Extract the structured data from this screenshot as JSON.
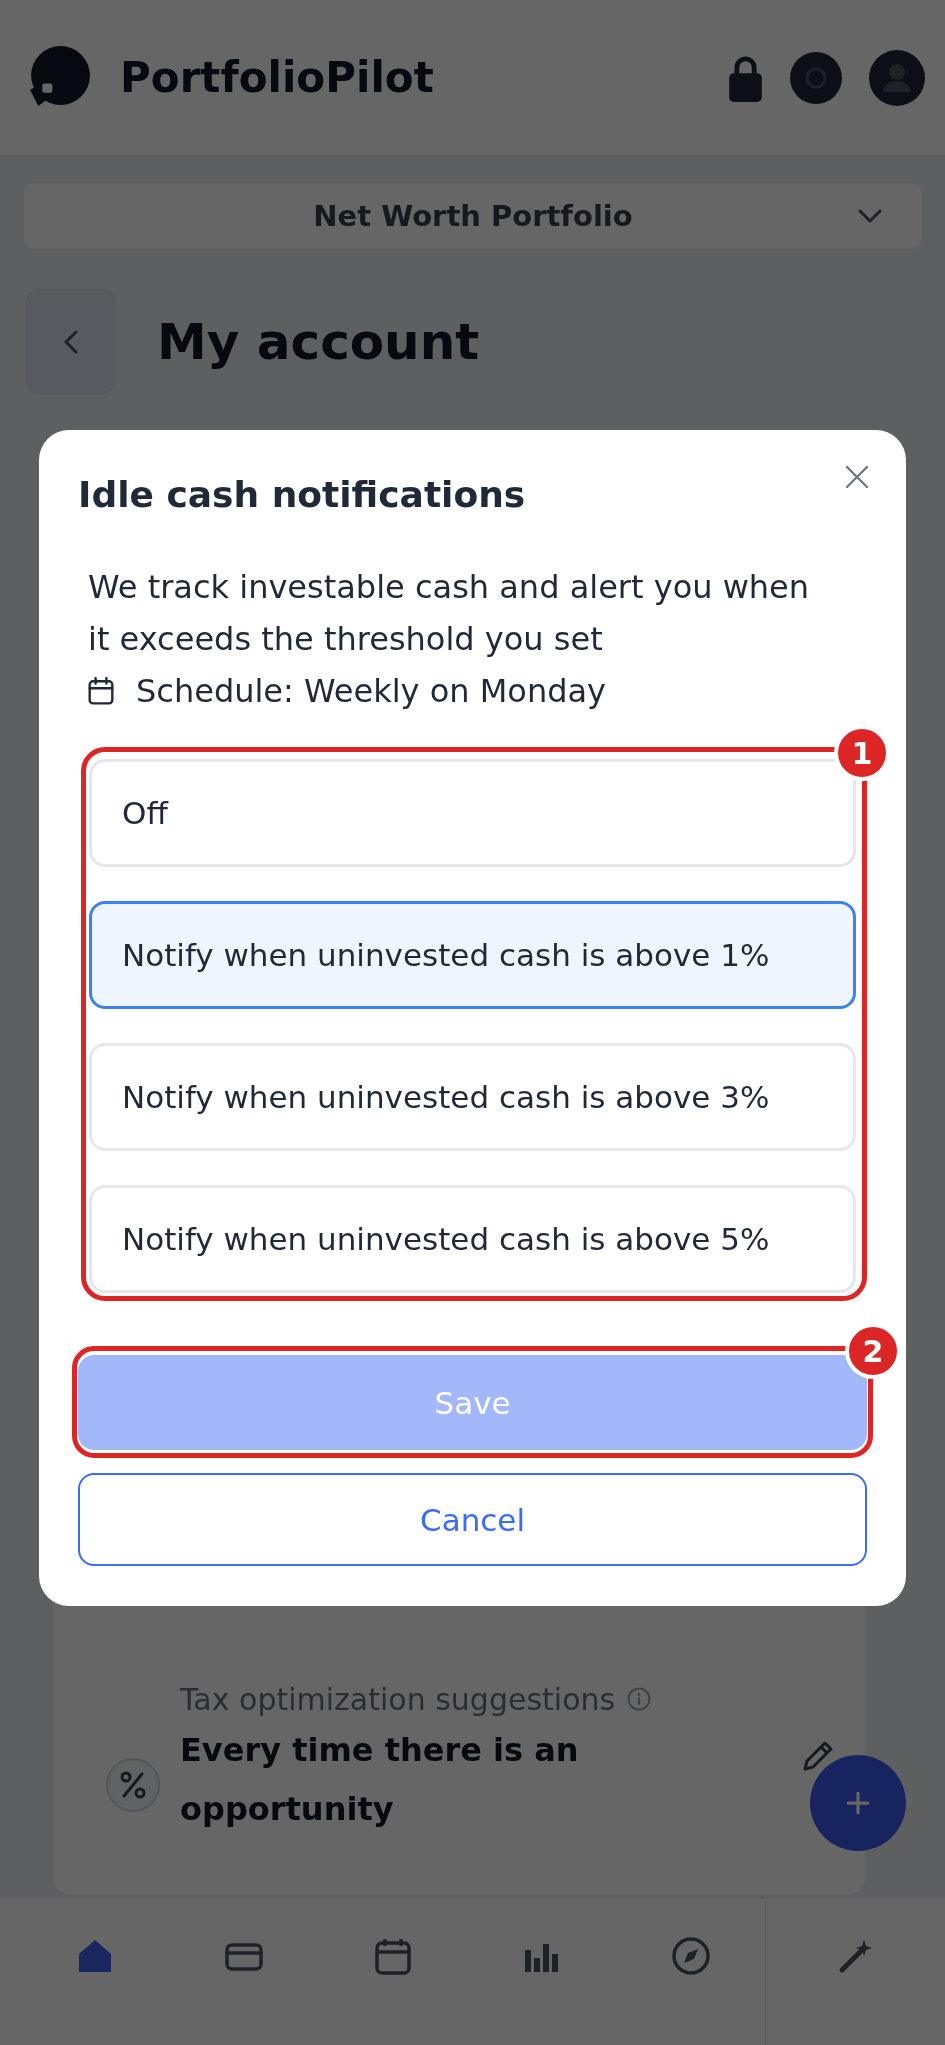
{
  "app_header": {
    "brand": "PortfolioPilot"
  },
  "portfolio_selector": {
    "value": "Net Worth Portfolio"
  },
  "page": {
    "title": "My account"
  },
  "setting_card": {
    "label": "Tax optimization suggestions",
    "value": "Every time there is an opportunity"
  },
  "bottom_nav": {
    "items": [
      {
        "selected": true
      },
      {
        "selected": false
      },
      {
        "selected": false
      },
      {
        "selected": false
      },
      {
        "selected": false
      },
      {
        "selected": false
      }
    ]
  },
  "modal": {
    "title": "Idle cash notifications",
    "description": "We track investable cash and alert you when it exceeds the threshold you set",
    "schedule": "Schedule: Weekly on Monday",
    "options": [
      {
        "label": "Off",
        "selected": false
      },
      {
        "label": "Notify when uninvested cash is above 1%",
        "selected": true
      },
      {
        "label": "Notify when uninvested cash is above 3%",
        "selected": false
      },
      {
        "label": "Notify when uninvested cash is above 5%",
        "selected": false
      }
    ],
    "buttons": {
      "save": {
        "label": "Save",
        "disabled": true
      },
      "cancel": {
        "label": "Cancel"
      }
    },
    "highlights": [
      {
        "label": "1"
      },
      {
        "label": "2"
      }
    ]
  }
}
